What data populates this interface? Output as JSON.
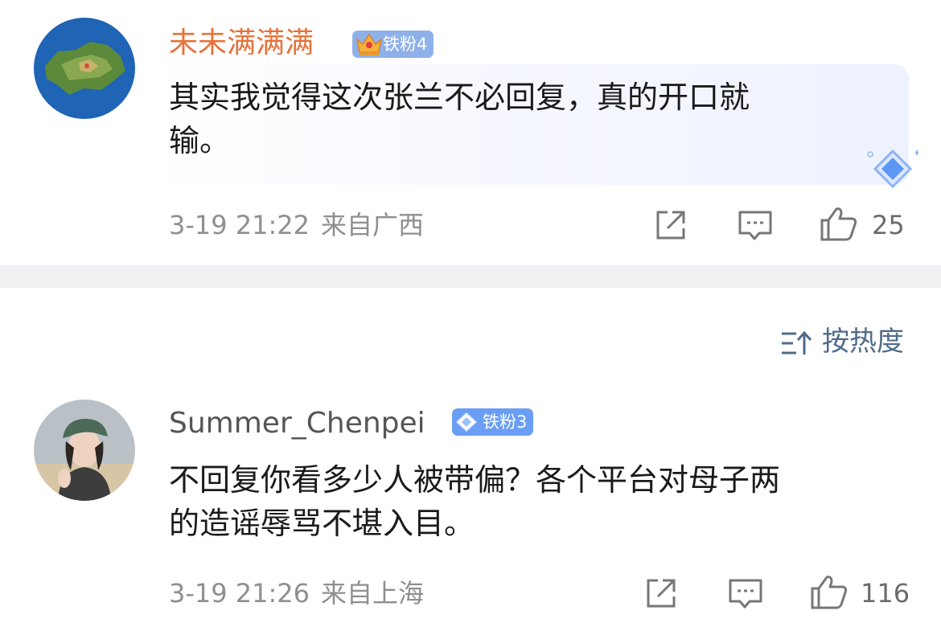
{
  "comments": [
    {
      "username": "未未满满满",
      "badge": "铁粉4",
      "text_line1": "其实我觉得这次张兰不必回复，真的开口就",
      "text_line2": "输。",
      "time": "3-19 21:22",
      "location": "来自广西",
      "likes": "25",
      "username_color": "#e8713a",
      "badge_color": "#8fb1ea"
    },
    {
      "username": "Summer_Chenpei",
      "badge": "铁粉3",
      "text_line1": "不回复你看多少人被带偏？各个平台对母子两",
      "text_line2": "的造谣辱骂不堪入目。",
      "time": "3-19 21:26",
      "location": "来自上海",
      "likes": "116",
      "username_color": "#555555",
      "badge_color": "#6a9ef5"
    }
  ],
  "sort": {
    "label": "按热度"
  },
  "icons": {
    "share": "share-icon",
    "reply": "reply-icon",
    "like": "thumbs-up-icon",
    "sort": "sort-icon",
    "crown": "crown-icon",
    "diamond": "diamond-icon"
  }
}
